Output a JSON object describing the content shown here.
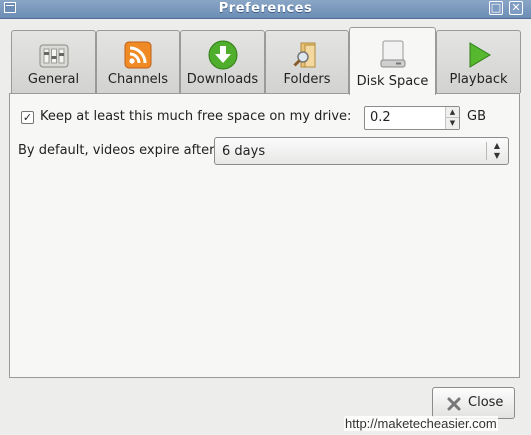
{
  "window": {
    "title": "Preferences",
    "maximize_glyph": "□",
    "close_glyph": "✕"
  },
  "tabs": [
    {
      "label": "General",
      "icon": "sliders-icon"
    },
    {
      "label": "Channels",
      "icon": "rss-feed-icon"
    },
    {
      "label": "Downloads",
      "icon": "download-arrow-icon"
    },
    {
      "label": "Folders",
      "icon": "folder-search-icon"
    },
    {
      "label": "Disk Space",
      "icon": "hard-drive-icon",
      "active": true
    },
    {
      "label": "Playback",
      "icon": "play-triangle-icon"
    }
  ],
  "disk_space": {
    "keep_free_checked": true,
    "keep_free_label": "Keep at least this much free space on my drive:",
    "keep_free_value": "0.2",
    "keep_free_unit": "GB",
    "expire_label": "By default, videos expire after",
    "expire_value": "6 days"
  },
  "buttons": {
    "close_label": "Close"
  },
  "watermark": "http://maketecheasier.com",
  "colors": {
    "titlebar": "#7a99be",
    "dialog_bg": "#ededec",
    "panel_bg": "#f7f7f6"
  }
}
